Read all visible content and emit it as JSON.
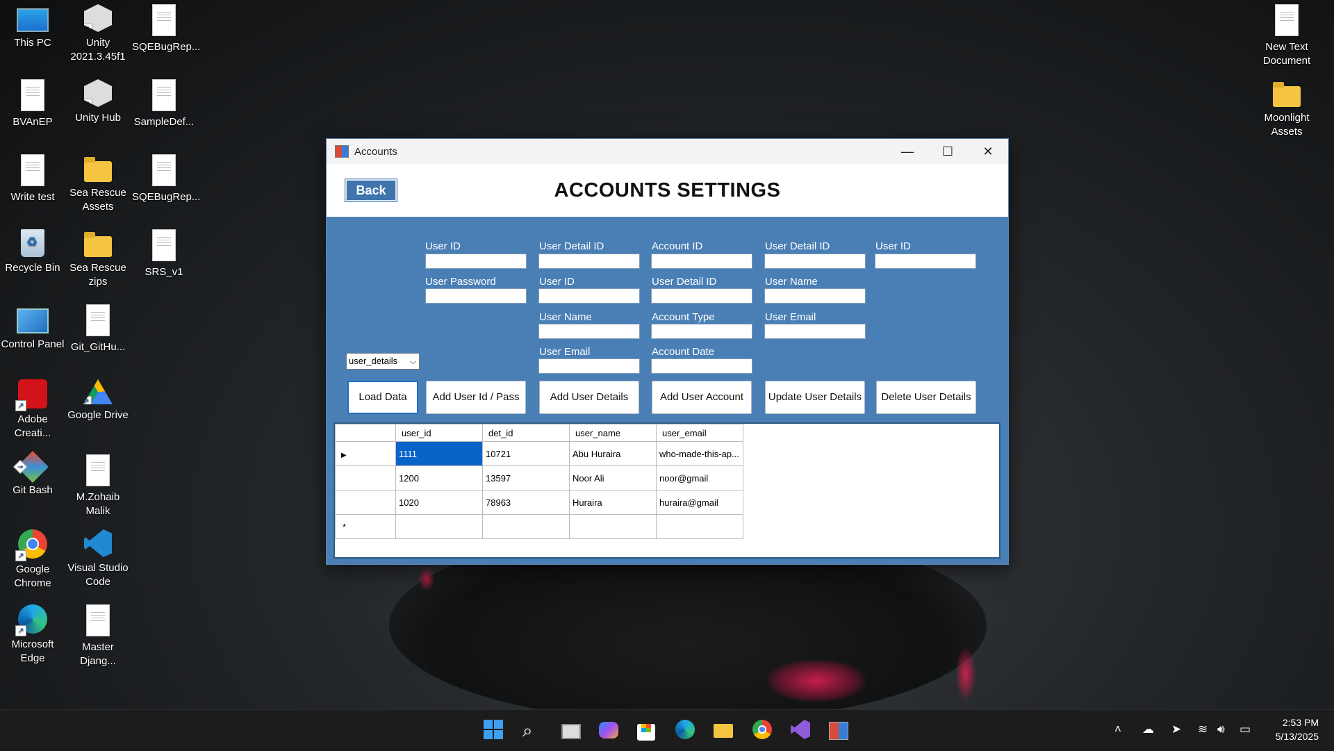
{
  "desktop": {
    "icons": [
      {
        "label": "This PC",
        "icon": "monitor-icon"
      },
      {
        "label": "Unity 2021.3.45f1",
        "icon": "unity-icon"
      },
      {
        "label": "SQEBugRep...",
        "icon": "document-icon"
      },
      {
        "label": "BVAnEP",
        "icon": "document-icon"
      },
      {
        "label": "Unity Hub",
        "icon": "unity-icon"
      },
      {
        "label": "SampleDef...",
        "icon": "document-icon"
      },
      {
        "label": "Write test",
        "icon": "document-icon"
      },
      {
        "label": "Sea Rescue Assets",
        "icon": "folder-icon"
      },
      {
        "label": "SQEBugRep...",
        "icon": "document-icon"
      },
      {
        "label": "Recycle Bin",
        "icon": "recycle-bin-icon"
      },
      {
        "label": "Sea Rescue zips",
        "icon": "folder-icon"
      },
      {
        "label": "SRS_v1",
        "icon": "document-icon"
      },
      {
        "label": "Control Panel",
        "icon": "control-panel-icon"
      },
      {
        "label": "Git_GitHu...",
        "icon": "document-icon"
      },
      {
        "label": "Adobe Creati...",
        "icon": "adobe-icon"
      },
      {
        "label": "Google Drive",
        "icon": "google-drive-icon"
      },
      {
        "label": "Git Bash",
        "icon": "git-bash-icon"
      },
      {
        "label": "M.Zohaib Malik",
        "icon": "document-icon"
      },
      {
        "label": "Google Chrome",
        "icon": "chrome-icon"
      },
      {
        "label": "Visual Studio Code",
        "icon": "vscode-icon"
      },
      {
        "label": "Microsoft Edge",
        "icon": "edge-icon"
      },
      {
        "label": "Master Djang...",
        "icon": "document-icon"
      },
      {
        "label": "New Text Document",
        "icon": "document-icon"
      },
      {
        "label": "Moonlight Assets",
        "icon": "folder-icon"
      }
    ]
  },
  "window": {
    "title": "Accounts",
    "minimize": "—",
    "maximize": "☐",
    "close": "✕",
    "back_label": "Back",
    "heading": "ACCOUNTS SETTINGS"
  },
  "form": {
    "col1": {
      "user_id": "User ID",
      "user_password": "User Password"
    },
    "col2": {
      "user_detail_id": "User Detail ID",
      "user_id": "User ID",
      "user_name": "User Name",
      "user_email": "User Email"
    },
    "col3": {
      "account_id": "Account ID",
      "user_detail_id": "User Detail ID",
      "account_type": "Account Type",
      "account_date": "Account Date"
    },
    "col4": {
      "user_detail_id": "User Detail ID",
      "user_name": "User Name",
      "user_email": "User Email"
    },
    "col5": {
      "user_id": "User ID"
    },
    "table_select": "user_details",
    "buttons": {
      "load": "Load Data",
      "add_user_pass": "Add User Id / Pass",
      "add_details": "Add User Details",
      "add_account": "Add User Account",
      "update_details": "Update User Details",
      "delete_details": "Delete User Details"
    }
  },
  "grid": {
    "columns": [
      "user_id",
      "det_id",
      "user_name",
      "user_email"
    ],
    "rows": [
      [
        "1111",
        "10721",
        "Abu Huraira",
        "who-made-this-ap..."
      ],
      [
        "1200",
        "13597",
        "Noor Ali",
        "noor@gmail"
      ],
      [
        "1020",
        "78963",
        "Huraira",
        "huraira@gmail"
      ]
    ],
    "current_row_marker": "▶",
    "new_row_marker": "*"
  },
  "taskbar": {
    "time": "2:53 PM",
    "date": "5/13/2025"
  }
}
